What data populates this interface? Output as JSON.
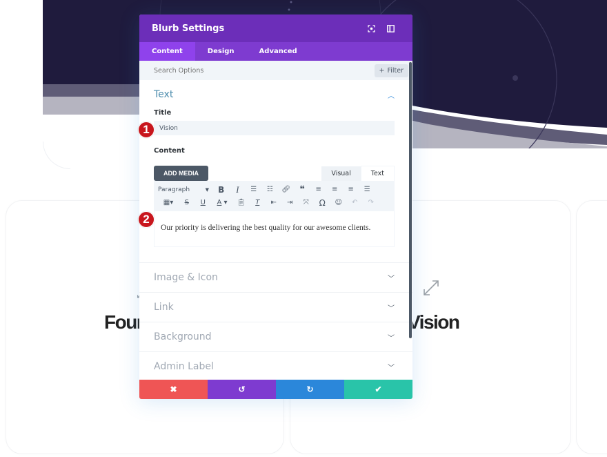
{
  "background": {
    "hero_color": "#1f1b3d",
    "cards": [
      {
        "title": "Four",
        "icon": "expand-arrows-icon"
      },
      {
        "title": "Vision",
        "icon": "expand-arrows-icon"
      },
      {
        "title": "",
        "icon": ""
      }
    ]
  },
  "modal": {
    "title": "Blurb Settings",
    "header_icons": [
      "expand-screen-icon",
      "sidebar-toggle-icon"
    ],
    "tabs": [
      {
        "label": "Content",
        "active": true
      },
      {
        "label": "Design",
        "active": false
      },
      {
        "label": "Advanced",
        "active": false
      }
    ],
    "search": {
      "placeholder": "Search Options",
      "filter_label": "Filter",
      "filter_icon": "+"
    },
    "sections": {
      "text": {
        "label": "Text",
        "open": true,
        "title_label": "Title",
        "title_value": "Vision",
        "content_label": "Content",
        "add_media_label": "ADD MEDIA",
        "mode_tabs": [
          "Visual",
          "Text"
        ],
        "toolbar": {
          "format_select": "Paragraph",
          "row1": [
            "bold",
            "italic",
            "bullet-list",
            "numbered-list",
            "link",
            "blockquote",
            "align-left",
            "align-center",
            "align-right",
            "justify"
          ],
          "row2": [
            "table",
            "strikethrough",
            "underline",
            "text-color",
            "paste-as-text",
            "clear-formatting",
            "indent",
            "outdent",
            "fullscreen",
            "special-character",
            "emoji",
            "undo",
            "redo"
          ]
        },
        "content_value": "Our priority is delivering the best quality for our awesome clients."
      },
      "collapsed": [
        {
          "label": "Image & Icon"
        },
        {
          "label": "Link"
        },
        {
          "label": "Background"
        },
        {
          "label": "Admin Label"
        }
      ]
    },
    "badges": [
      "1",
      "2"
    ],
    "footer": {
      "cancel": {
        "icon": "✖",
        "color": "#ef5555"
      },
      "undo": {
        "icon": "↺",
        "color": "#7e3bd0"
      },
      "redo": {
        "icon": "↻",
        "color": "#2b87da"
      },
      "save": {
        "icon": "✔",
        "color": "#29c4a9"
      }
    }
  }
}
